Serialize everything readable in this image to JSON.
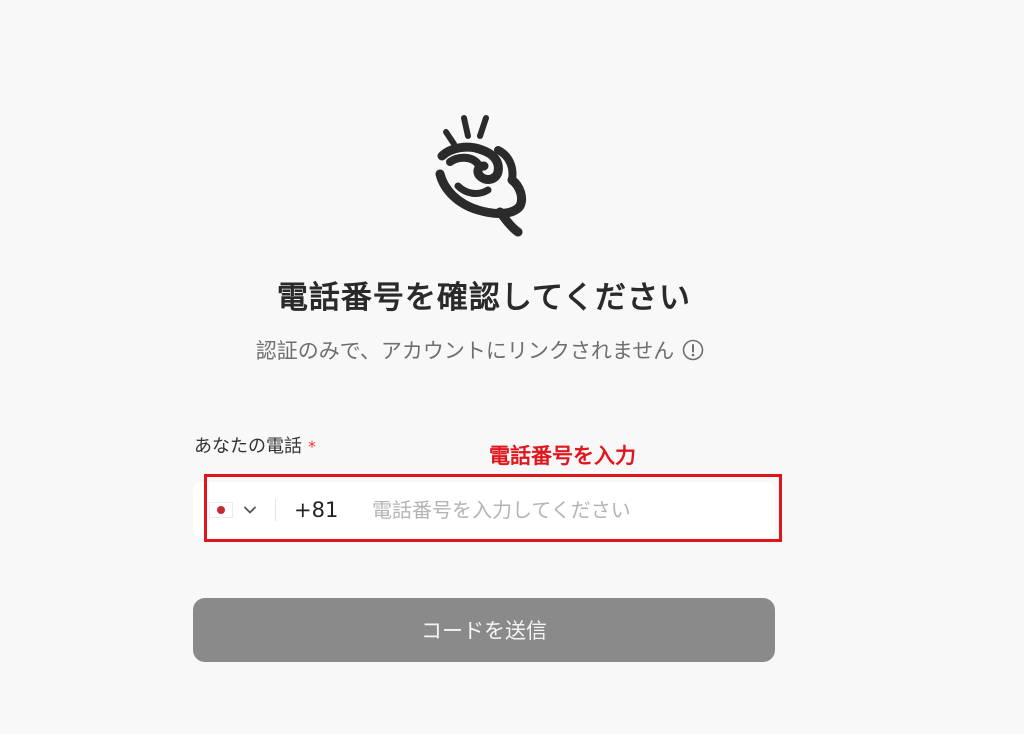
{
  "header": {
    "title": "電話番号を確認してください",
    "subtitle": "認証のみで、アカウントにリンクされません"
  },
  "phone_field": {
    "label": "あなたの電話",
    "required_marker": "*",
    "country_flag": "japan-flag",
    "dial_code": "+81",
    "value": "",
    "placeholder": "電話番号を入力してください"
  },
  "annotation": {
    "label": "電話番号を入力",
    "color": "#e0161c"
  },
  "submit": {
    "label": "コードを送信"
  },
  "colors": {
    "background": "#f8f8f8",
    "button": "#8a8a8a",
    "required": "#e53935"
  },
  "icons": {
    "logo": "hand-gesture-logo",
    "info": "info-icon",
    "dropdown": "chevron-down-icon"
  }
}
